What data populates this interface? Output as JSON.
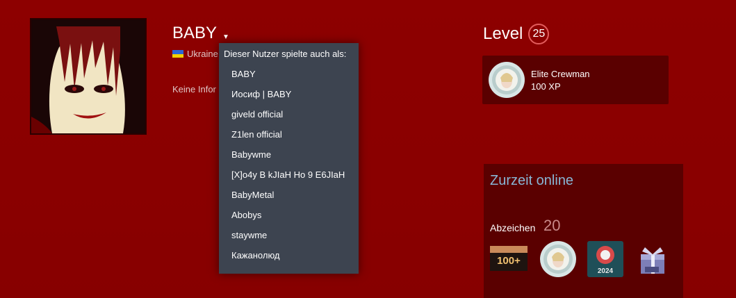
{
  "profile": {
    "persona_name": "BABY",
    "location": "Ukraine",
    "no_info": "Keine Infor"
  },
  "aliases": {
    "heading": "Dieser Nutzer spielte auch als:",
    "items": [
      "BABY",
      "Иосиф | BABY",
      "giveld official",
      "Z1len official",
      "Babywme",
      "[X]o4y B kJIaH Ho 9 E6JIaH",
      "BabyMetal",
      "Abobys",
      "staywme",
      "Кажанолюд"
    ]
  },
  "level": {
    "label": "Level",
    "value": "25"
  },
  "featured_badge": {
    "name": "Elite Crewman",
    "xp": "100 XP"
  },
  "status": {
    "online": "Zurzeit online"
  },
  "badges": {
    "label": "Abzeichen",
    "count": "20",
    "icons": [
      "100-plus-badge-icon",
      "elite-crewman-badge-icon",
      "steam-2024-badge-icon",
      "gift-box-2024-badge-icon"
    ]
  },
  "colors": {
    "background": "#8a0000",
    "panel": "#5a0000",
    "dropdown": "#3d4450",
    "online_text": "#88b7d6",
    "level_ring": "#e25d5d"
  }
}
